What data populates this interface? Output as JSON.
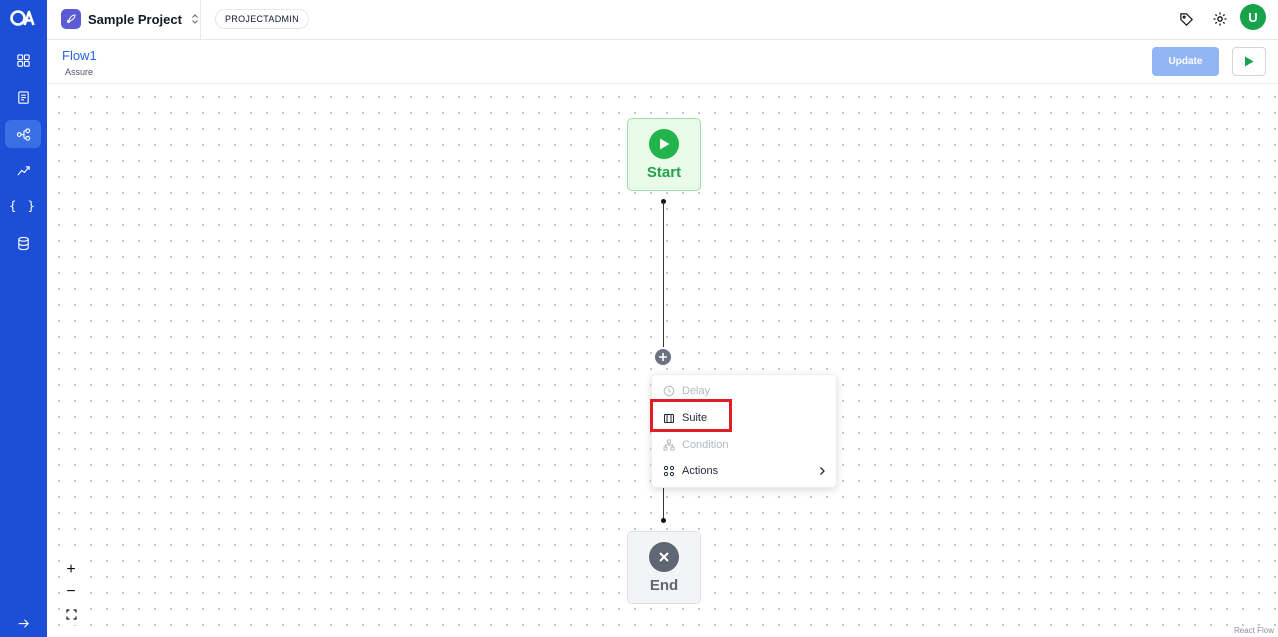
{
  "project": {
    "name": "Sample Project",
    "role": "PROJECTADMIN"
  },
  "user": {
    "avatar_initial": "U",
    "avatar_color": "#16a34a"
  },
  "flow": {
    "title": "Flow1",
    "subtitle": "Assure"
  },
  "header": {
    "update_label": "Update"
  },
  "nodes": {
    "start_label": "Start",
    "end_label": "End"
  },
  "menu": {
    "items": [
      {
        "label": "Delay",
        "icon": "clock-icon",
        "disabled": true
      },
      {
        "label": "Suite",
        "icon": "suite-icon",
        "disabled": false,
        "highlighted": true
      },
      {
        "label": "Condition",
        "icon": "condition-icon",
        "disabled": true
      },
      {
        "label": "Actions",
        "icon": "actions-icon",
        "disabled": false,
        "has_submenu": true
      }
    ]
  },
  "zoom": {
    "in": "+",
    "out": "−"
  },
  "attribution": "React Flow",
  "colors": {
    "rail": "#1d4ed8",
    "accent": "#2563eb",
    "start": "#22b34a",
    "highlight": "#e11d26"
  }
}
